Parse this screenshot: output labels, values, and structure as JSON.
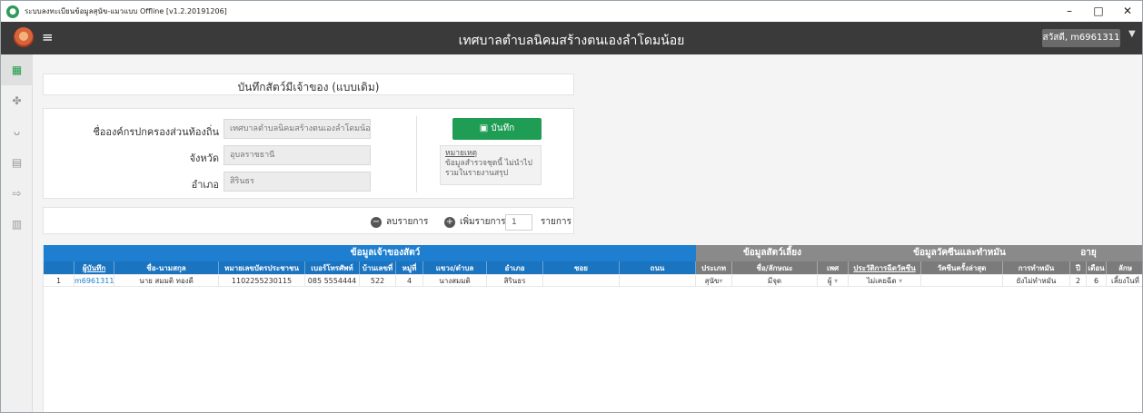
{
  "window": {
    "title": "ระบบลงทะเบียนข้อมูลสุนัข-แมวแบบ Offline [v1.2.20191206]",
    "controls": [
      "–",
      "□",
      "✕"
    ]
  },
  "topbar": {
    "center_title": "เทศบาลตำบลนิคมสร้างตนเองลำโดมน้อย",
    "user": "สวัสดี, m6961311",
    "menu_icon": "hamburger-icon"
  },
  "sidebar": {
    "items": [
      "dashboard-icon",
      "dog-icon",
      "cat-icon",
      "document-icon",
      "logout-icon",
      "report-icon"
    ]
  },
  "header": {
    "title": "บันทึกสัตว์มีเจ้าของ (แบบเดิม)"
  },
  "form": {
    "org_label": "ชื่อองค์กรปกครองส่วนท้องถิ่น",
    "org_value": "เทศบาลตำบลนิคมสร้างตนเองลำโดมน้อย",
    "province_label": "จังหวัด",
    "province_value": "อุบลราชธานี",
    "district_label": "อำเภอ",
    "district_value": "สิรินธร",
    "save_label": "บันทึก",
    "note_title": "หมายเหตุ",
    "note_text": "ข้อมูลสำรวจชุดนี้ ไม่นำไปรวมในรายงานสรุป"
  },
  "rows": {
    "remove_label": "ลบรายการ",
    "add_label": "เพิ่มรายการ",
    "count": "1",
    "unit_label": "รายการ"
  },
  "grid": {
    "groups": {
      "owner": "ข้อมูลเจ้าของสัตว์",
      "animal": "ข้อมูลสัตว์เลี้ยง",
      "vaccine": "ข้อมูลวัคซีนและทำหมัน",
      "age": "อายุ"
    },
    "columns": {
      "recorder": "ผู้บันทึก",
      "name": "ชื่อ-นามสกุล",
      "id": "หมายเลขบัตรประชาชน",
      "phone": "เบอร์โทรศัพท์",
      "house": "บ้านเลขที่",
      "moo": "หมู่ที่",
      "tambon": "แขวง/ตำบล",
      "amphoe": "อำเภอ",
      "soi": "ซอย",
      "road": "ถนน",
      "type": "ประเภท",
      "animal_name": "ชื่อ/ลักษณะ",
      "sex": "เพศ",
      "vac_history": "ประวัติการฉีดวัคซีน",
      "last_vac": "วัคซีนครั้งล่าสุด",
      "sterile": "การทำหมัน",
      "year": "ปี",
      "month": "เดือน",
      "more": "ลักษ"
    },
    "row": {
      "index": "1",
      "recorder": "m6961311",
      "name": "นาย สมมติ ทองดี",
      "id": "1102255230115",
      "phone": "085 5554444",
      "house": "522",
      "moo": "4",
      "tambon": "นางสมมติ",
      "amphoe": "สิรินธร",
      "type": "สุนัข",
      "animal_name": "มีจุด",
      "sex": "ผู้",
      "vac_history": "ไม่เคยฉีด",
      "sterile": "ยังไม่ทำหมัน",
      "year": "2",
      "month": "6",
      "more": "เลี้ยงในที่"
    }
  }
}
